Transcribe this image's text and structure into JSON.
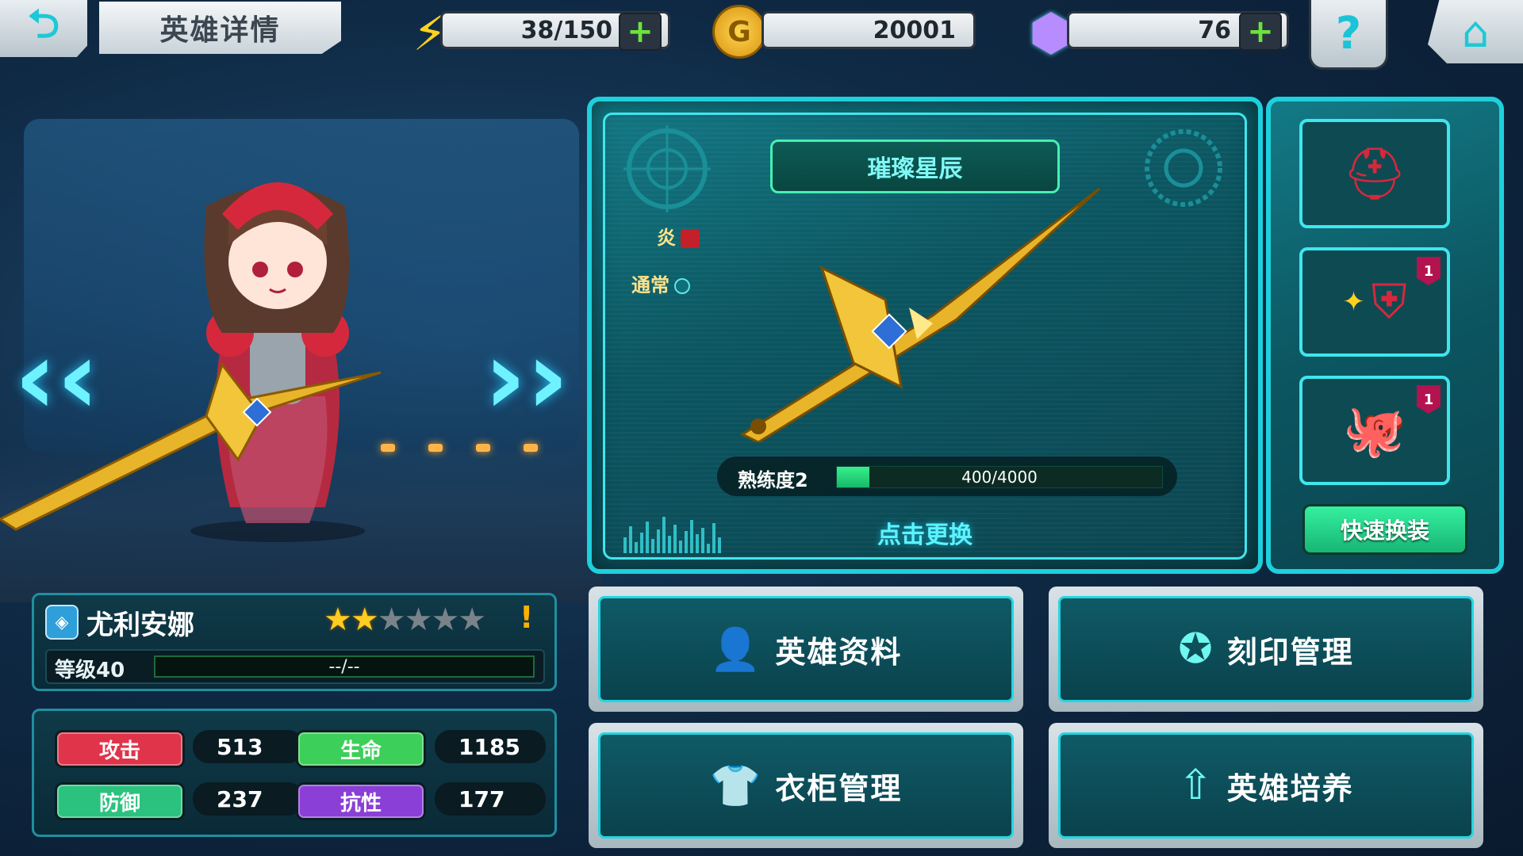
{
  "header": {
    "back_icon": "back-arrow-icon",
    "title": "英雄详情",
    "energy": "38/150",
    "gold": "20001",
    "gems": "76",
    "help_icon": "question-icon",
    "home_icon": "home-icon"
  },
  "hero": {
    "name": "尤利安娜",
    "stars_filled": 2,
    "stars_total": 6,
    "level_label": "等级40",
    "exp_text": "--/--",
    "stats": [
      {
        "label": "攻击",
        "value": "513",
        "color": "#e0344a"
      },
      {
        "label": "生命",
        "value": "1185",
        "color": "#3ccf5a"
      },
      {
        "label": "防御",
        "value": "237",
        "color": "#2bc27f"
      },
      {
        "label": "抗性",
        "value": "177",
        "color": "#8a3fd6"
      }
    ]
  },
  "weapon": {
    "name": "璀璨星辰",
    "element": "炎",
    "attack_type": "通常",
    "proficiency_label": "熟练度2",
    "proficiency_text": "400/4000",
    "proficiency_fraction": 0.1,
    "click_change": "点击更换"
  },
  "equipment": {
    "slots": [
      {
        "icon": "helmet-icon",
        "badge": ""
      },
      {
        "icon": "armor-icon",
        "badge": "1"
      },
      {
        "icon": "octopus-pet-icon",
        "badge": "1"
      }
    ],
    "quick_equip": "快速换装"
  },
  "menu": {
    "hero_info": "英雄资料",
    "imprint": "刻印管理",
    "wardrobe": "衣柜管理",
    "training": "英雄培养"
  },
  "colors": {
    "accent": "#1ed0dc",
    "proficiency": "#38f08b",
    "star": "#ffcc22"
  }
}
